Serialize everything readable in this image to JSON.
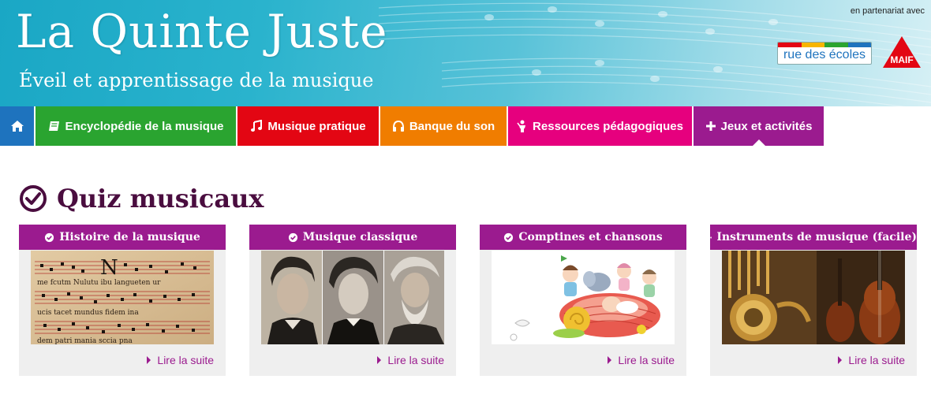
{
  "header": {
    "title": "La Quinte Juste",
    "subtitle": "Éveil et apprentissage de la musique",
    "partner_text": "en partenariat avec",
    "partner_logo_text": "rue des écoles",
    "partner2_logo_text": "MAIF"
  },
  "nav": {
    "home_icon": "home-icon",
    "items": [
      {
        "label": "Encyclopédie de la musique",
        "icon": "book-icon",
        "color": "#2aa430"
      },
      {
        "label": "Musique pratique",
        "icon": "music-note-icon",
        "color": "#e30613"
      },
      {
        "label": "Banque du son",
        "icon": "headphones-icon",
        "color": "#f07d00"
      },
      {
        "label": "Ressources pédagogiques",
        "icon": "teacher-icon",
        "color": "#e6007e"
      },
      {
        "label": "Jeux et activités",
        "icon": "plus-icon",
        "color": "#9b1b8f"
      }
    ]
  },
  "main": {
    "heading": "Quiz musicaux",
    "cards": [
      {
        "title": "Histoire de la musique",
        "image": "medieval-manuscript",
        "link": "Lire la suite"
      },
      {
        "title": "Musique classique",
        "image": "composer-portraits",
        "link": "Lire la suite"
      },
      {
        "title": "Comptines et chansons",
        "image": "children-illustration",
        "link": "Lire la suite"
      },
      {
        "title": "Instruments de musique (facile)",
        "image": "brass-and-violin",
        "link": "Lire la suite"
      }
    ]
  },
  "colors": {
    "accent": "#9b1b8f",
    "heading": "#4a0d3f",
    "home": "#1e73be"
  }
}
